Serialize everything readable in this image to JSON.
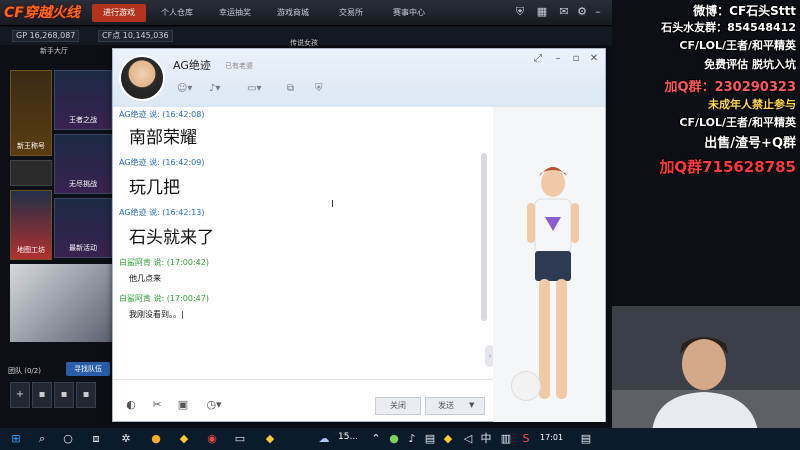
{
  "game": {
    "logo": "CF穿越火线",
    "nav": [
      "进行游戏",
      "个人仓库",
      "幸运抽奖",
      "游戏商城",
      "交易所",
      "赛事中心"
    ],
    "header_icons": [
      "shield-icon",
      "gift-icon",
      "chat-bubble-icon",
      "settings-icon",
      "minimize-icon",
      "maximize-icon",
      "close-icon"
    ],
    "gp_label": "GP",
    "gp_value": "16,268,087",
    "cf_label": "CF点",
    "cf_value": "10,145,036",
    "channel": "传说女孩",
    "lobby": "新手大厅",
    "cards": [
      {
        "label": "新王称号",
        "sub": "宝藏刀"
      },
      {
        "label": "无尽挑战",
        "sub": "挑战"
      },
      {
        "label": "地图工坊",
        "sub": "尽享精彩"
      }
    ],
    "cards_right": [
      "王者之战",
      "无尽挑战",
      "最新活动"
    ],
    "team": {
      "label": "团队 (0/2)",
      "button": "寻找队伍",
      "slots": [
        "+",
        "🔒",
        "🔒",
        "🔒",
        "🔒"
      ]
    }
  },
  "chat": {
    "name": "AG绝迹",
    "status": "已有老婆",
    "toolbar_icons": [
      "smiley-icon",
      "mic-icon",
      "video-icon",
      "screen-icon",
      "folder-icon",
      "shield-icon"
    ],
    "window_controls": [
      "mode-icon",
      "minimize-icon",
      "maximize-icon",
      "close-icon"
    ],
    "messages": [
      {
        "sender": "AG绝迹 说: (16:42:08)",
        "text": "南部荣耀",
        "size": "big",
        "color": "blue"
      },
      {
        "sender": "AG绝迹 说: (16:42:09)",
        "text": "玩几把",
        "size": "big",
        "color": "blue"
      },
      {
        "sender": "AG绝迹 说: (16:42:13)",
        "text": "石头就来了",
        "size": "big",
        "color": "blue"
      },
      {
        "sender": "白鲨阿肯 说: (17:00:42)",
        "text": "他几点来",
        "size": "small",
        "color": "green"
      },
      {
        "sender": "白鲨阿肯 说: (17:00:47)",
        "text": "我刚没看到。。|",
        "size": "small",
        "color": "green"
      }
    ],
    "cursor": "I",
    "bottom_icons": [
      "palette-icon",
      "scissors-icon",
      "image-icon",
      "clock-icon"
    ],
    "close_label": "关闭",
    "send_label": "发送",
    "send_arrow": "▼",
    "collapse": "›"
  },
  "overlay": [
    {
      "text": "微博：CF石头Sttt",
      "color": "#ffffff"
    },
    {
      "text": "石头水友群：854548412",
      "color": "#ffffff"
    },
    {
      "text": "CF/LOL/王者/和平精英",
      "color": "#ffffff"
    },
    {
      "text": "免费评估 脱坑入坑",
      "color": "#ffffff"
    },
    {
      "text": "加Q群：230290323",
      "color": "#ff5a5a"
    },
    {
      "text": "未成年人禁止参与",
      "color": "#ffd84a"
    },
    {
      "text": "CF/LOL/王者/和平精英",
      "color": "#ffffff"
    },
    {
      "text": "出售/渣号+Q群",
      "color": "#ffffff"
    },
    {
      "text": "加Q群715628785",
      "color": "#ff3b3b"
    }
  ],
  "taskbar": {
    "temp": "15...",
    "time": "17:01",
    "icons_left": [
      "windows-icon",
      "search-icon",
      "task-view-icon",
      "multitask-icon",
      "settings-icon",
      "app-yellow-icon",
      "app-cat-icon",
      "chrome-icon",
      "folder-icon",
      "monitor-icon",
      "app-cat2-icon"
    ],
    "icons_right": [
      "weather-icon",
      "chevron-up-icon",
      "app-green-icon",
      "mic-icon",
      "speaker-icon",
      "network-icon",
      "volume-icon",
      "ime-icon",
      "sogou-icon",
      "notification-icon"
    ]
  }
}
